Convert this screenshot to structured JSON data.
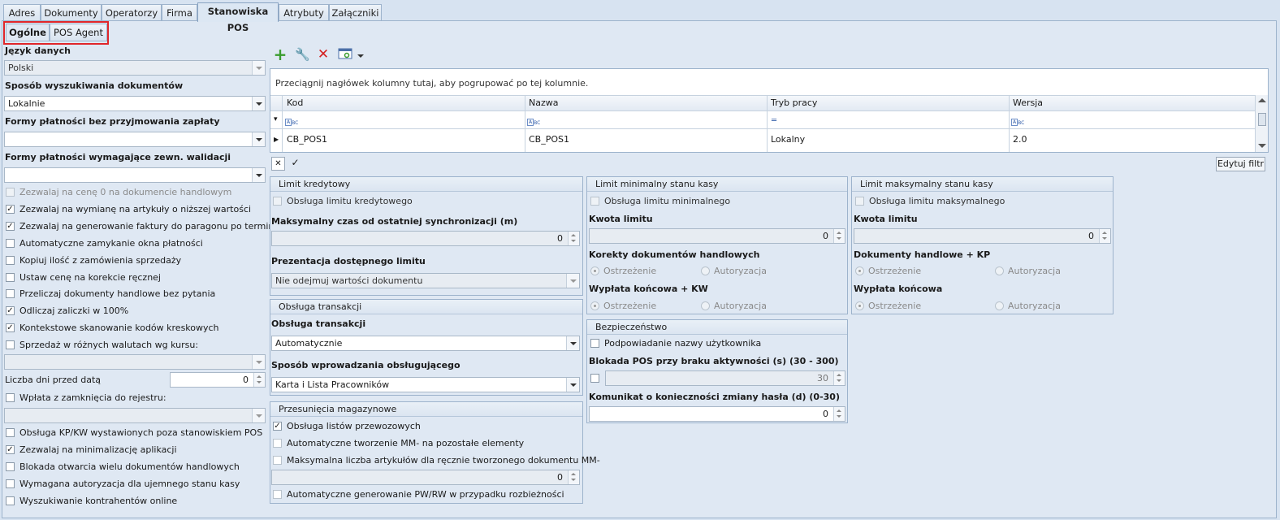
{
  "tabs": [
    "Adres",
    "Dokumenty",
    "Operatorzy",
    "Firma",
    "Stanowiska POS",
    "Atrybuty",
    "Załączniki"
  ],
  "subtabs": [
    "Ogólne",
    "POS Agent"
  ],
  "left": {
    "jezyk_label": "Język danych",
    "jezyk_value": "Polski",
    "sposob_label": "Sposób wyszukiwania dokumentów",
    "sposob_value": "Lokalnie",
    "formy_bez_label": "Formy płatności bez przyjmowania zapłaty",
    "formy_bez_value": "",
    "formy_wym_label": "Formy płatności wymagające zewn. walidacji",
    "formy_wym_value": "",
    "checks": [
      {
        "label": "Zezwalaj na cenę 0 na dokumencie handlowym",
        "checked": false,
        "disabled": true
      },
      {
        "label": "Zezwalaj na wymianę na artykuły o niższej wartości",
        "checked": true,
        "disabled": false
      },
      {
        "label": "Zezwalaj na generowanie faktury do paragonu po terminie",
        "checked": true,
        "disabled": false
      },
      {
        "label": "Automatyczne zamykanie okna płatności",
        "checked": false,
        "disabled": false
      },
      {
        "label": "Kopiuj ilość z zamówienia sprzedaży",
        "checked": false,
        "disabled": false
      },
      {
        "label": "Ustaw cenę na korekcie ręcznej",
        "checked": false,
        "disabled": false
      },
      {
        "label": "Przeliczaj dokumenty handlowe bez pytania",
        "checked": false,
        "disabled": false
      },
      {
        "label": "Odliczaj zaliczki w 100%",
        "checked": true,
        "disabled": false
      },
      {
        "label": "Kontekstowe skanowanie kodów kreskowych",
        "checked": true,
        "disabled": false
      },
      {
        "label": "Sprzedaż w różnych walutach wg kursu:",
        "checked": false,
        "disabled": false
      }
    ],
    "kurs_value": "",
    "liczba_dni_label": "Liczba dni przed datą",
    "liczba_dni_value": "0",
    "wplata_label": "Wpłata z zamknięcia do rejestru:",
    "wplata_value": "",
    "checks2": [
      {
        "label": "Obsługa KP/KW wystawionych poza stanowiskiem POS",
        "checked": false
      },
      {
        "label": "Zezwalaj na minimalizację aplikacji",
        "checked": true
      },
      {
        "label": "Blokada otwarcia wielu dokumentów handlowych",
        "checked": false
      },
      {
        "label": "Wymagana autoryzacja dla ujemnego stanu kasy",
        "checked": false
      },
      {
        "label": "Wyszukiwanie kontrahentów online",
        "checked": false
      }
    ]
  },
  "grid": {
    "group_hint": "Przeciągnij nagłówek kolumny tutaj, aby pogrupować po tej kolumnie.",
    "columns": [
      "Kod",
      "Nazwa",
      "Tryb pracy",
      "Wersja"
    ],
    "row": [
      "CB_POS1",
      "CB_POS1",
      "Lokalny",
      "2.0"
    ],
    "edit_filter": "Edytuj filtr"
  },
  "limit_kred": {
    "title": "Limit kredytowy",
    "check": "Obsługa limitu kredytowego",
    "max_czas_label": "Maksymalny czas od ostatniej synchronizacji (m)",
    "max_czas_value": "0",
    "prezentacja_label": "Prezentacja dostępnego limitu",
    "prezentacja_value": "Nie odejmuj wartości dokumentu"
  },
  "transakcje": {
    "title": "Obsługa transakcji",
    "label": "Obsługa transakcji",
    "value": "Automatycznie",
    "sposob_label": "Sposób wprowadzania obsługującego",
    "sposob_value": "Karta i Lista Pracowników"
  },
  "przesuniecia": {
    "title": "Przesunięcia magazynowe",
    "c1": "Obsługa listów przewozowych",
    "c2": "Automatyczne tworzenie MM- na pozostałe elementy",
    "c3": "Maksymalna liczba artykułów dla ręcznie tworzonego dokumentu MM-",
    "c3_value": "0",
    "c4": "Automatyczne generowanie PW/RW w przypadku rozbieżności"
  },
  "limit_min": {
    "title": "Limit minimalny stanu kasy",
    "check": "Obsługa limitu minimalnego",
    "kwota_label": "Kwota limitu",
    "kwota_value": "0",
    "korekty_label": "Korekty dokumentów handlowych",
    "ostrzezenie": "Ostrzeżenie",
    "autoryzacja": "Autoryzacja",
    "wyplata_label": "Wypłata końcowa + KW"
  },
  "bezpieczenstwo": {
    "title": "Bezpieczeństwo",
    "check": "Podpowiadanie nazwy użytkownika",
    "blokada_label": "Blokada POS przy braku aktywności (s) (30 - 300)",
    "blokada_value": "30",
    "komunikat_label": "Komunikat o konieczności zmiany hasła (d) (0-30)",
    "komunikat_value": "0"
  },
  "limit_max": {
    "title": "Limit maksymalny stanu kasy",
    "check": "Obsługa limitu maksymalnego",
    "kwota_label": "Kwota limitu",
    "kwota_value": "0",
    "dok_label": "Dokumenty handlowe + KP",
    "ostrzezenie": "Ostrzeżenie",
    "autoryzacja": "Autoryzacja",
    "wyplata_label": "Wypłata końcowa"
  },
  "icons": {
    "add": "add-icon",
    "edit": "wrench-icon",
    "delete": "delete-icon",
    "view": "view-icon"
  },
  "colors": {
    "accent_red": "#e0262a",
    "add_green": "#3a9c2e",
    "delete_red": "#d42020"
  }
}
